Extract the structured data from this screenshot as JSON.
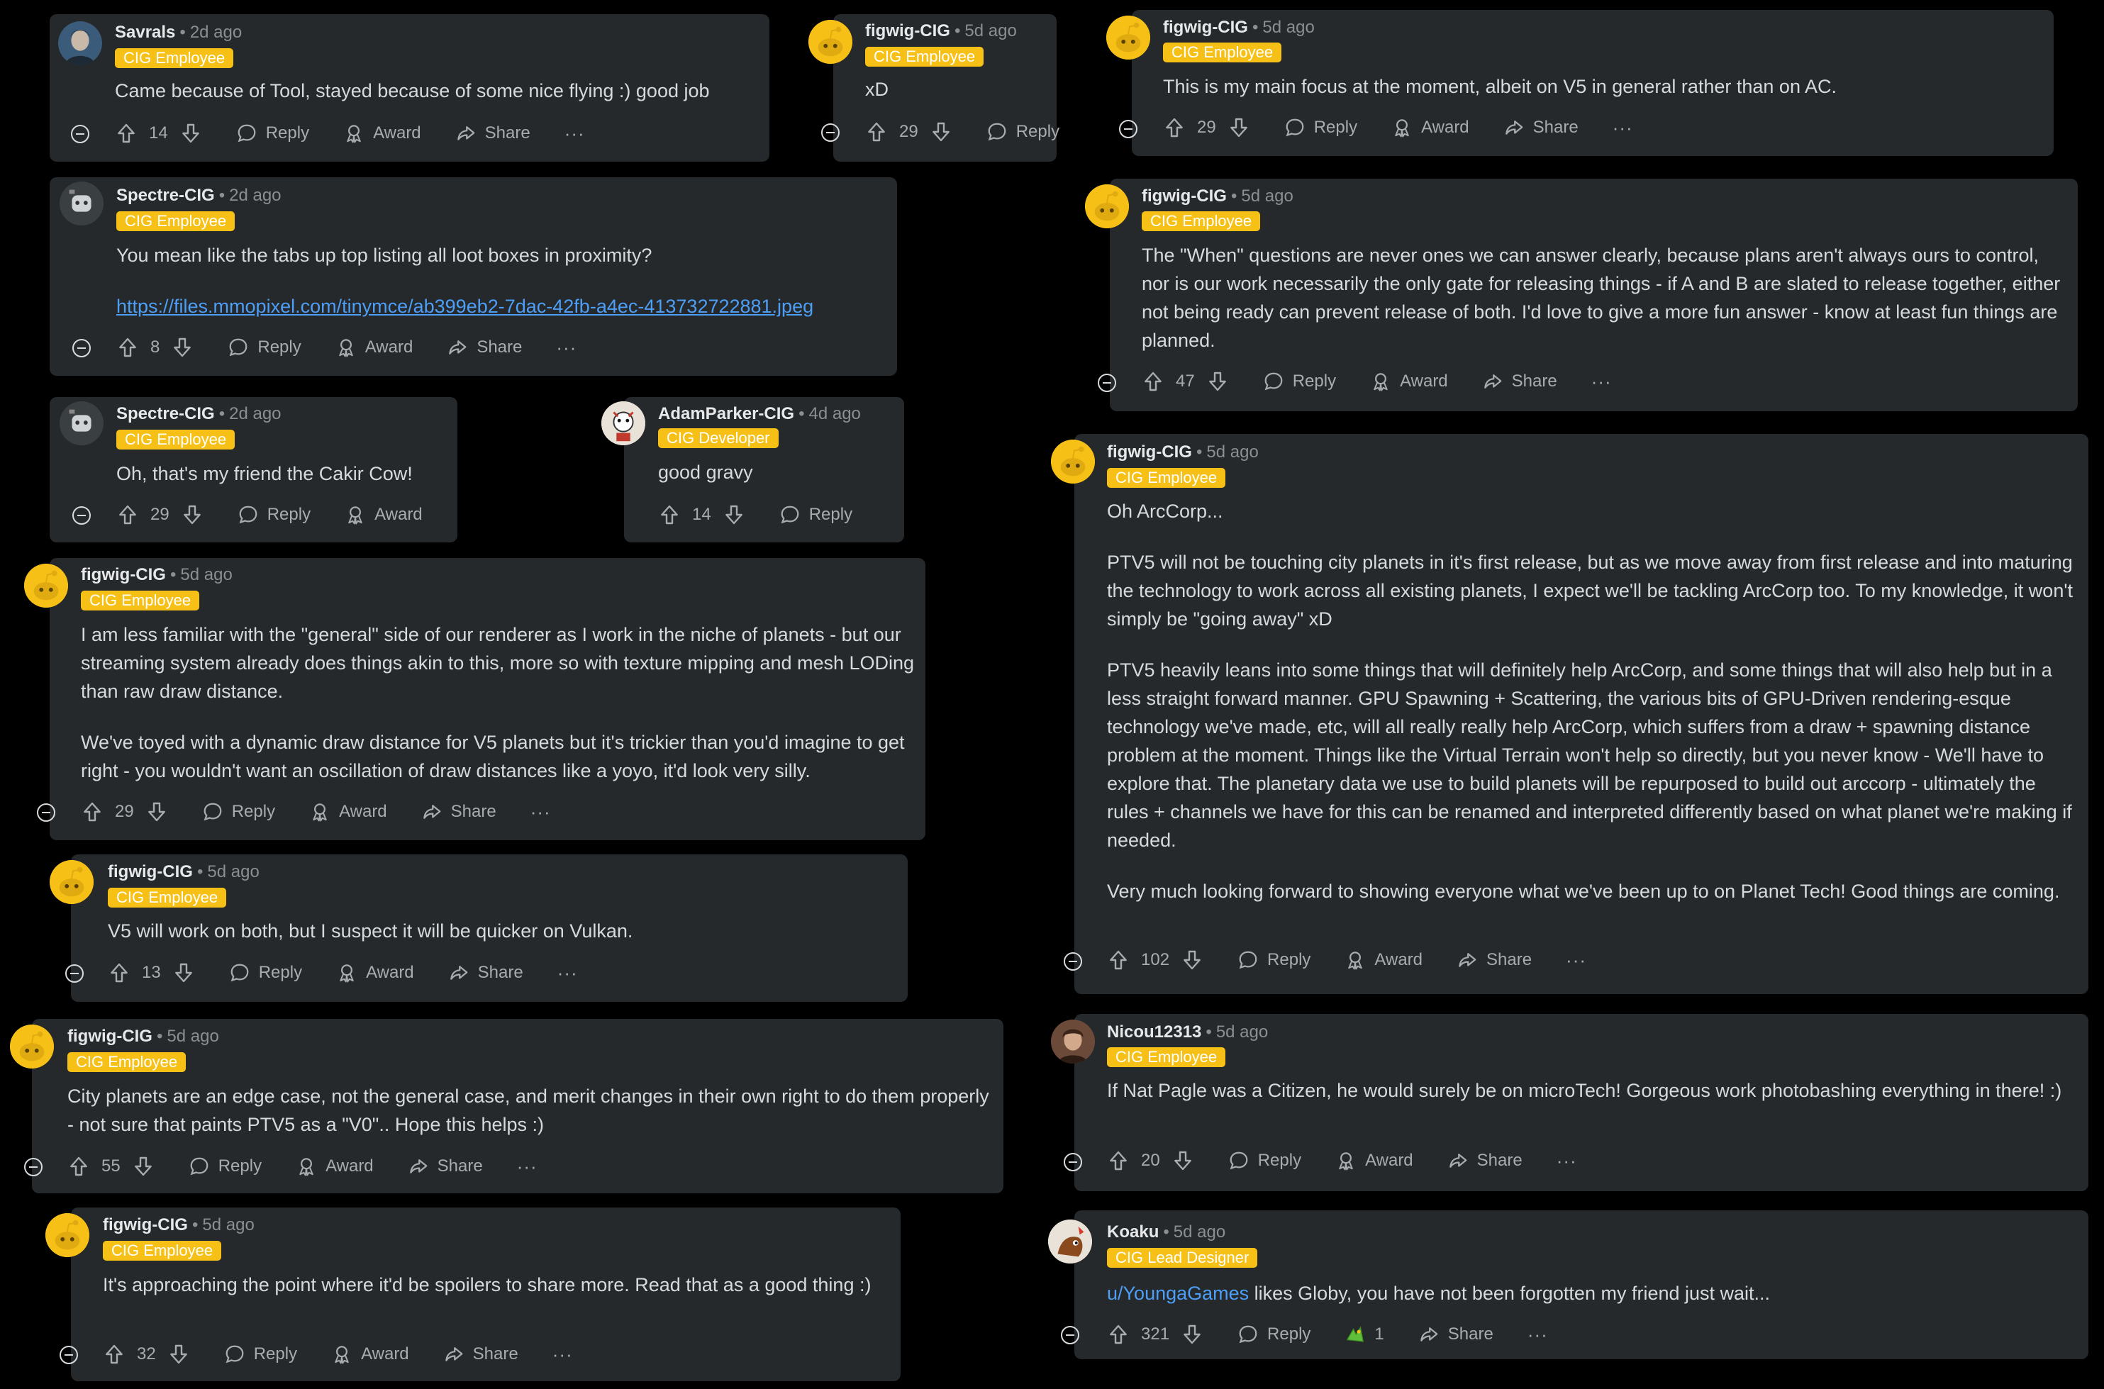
{
  "labels": {
    "reply": "Reply",
    "award": "Award",
    "share": "Share",
    "more": "···",
    "dot": "•"
  },
  "colors": {
    "background": "#000000",
    "card": "#25292b",
    "flair": "#f6c016",
    "upvoted": "#ff4500",
    "link": "#4d9ef6"
  },
  "comments": [
    {
      "user": "Savrals",
      "time": "2d ago",
      "flair": "CIG Employee",
      "text": "Came because of Tool, stayed because of some nice flying :) good job",
      "score": "14"
    },
    {
      "user": "figwig-CIG",
      "time": "5d ago",
      "flair": "CIG Employee",
      "text": "xD",
      "score": "29"
    },
    {
      "user": "figwig-CIG",
      "time": "5d ago",
      "flair": "CIG Employee",
      "text": "This is my main focus at the moment, albeit on V5 in general rather than on AC.",
      "score": "29"
    },
    {
      "user": "Spectre-CIG",
      "time": "2d ago",
      "flair": "CIG Employee",
      "text": "You mean like the tabs up top listing all loot boxes in proximity?",
      "link": "https://files.mmopixel.com/tinymce/ab399eb2-7dac-42fb-a4ec-413732722881.jpeg",
      "score": "8"
    },
    {
      "user": "figwig-CIG",
      "time": "5d ago",
      "flair": "CIG Employee",
      "text": "The \"When\" questions are never ones we can answer clearly, because plans aren't always ours to control, nor is our work necessarily the only gate for releasing things - if A and B are slated to release together, either not being ready can prevent release of both. I'd love to give a more fun answer - know at least fun things are planned.",
      "score": "47"
    },
    {
      "user": "Spectre-CIG",
      "time": "2d ago",
      "flair": "CIG Employee",
      "text": "Oh, that's my friend the Cakir Cow!",
      "score": "29"
    },
    {
      "user": "AdamParker-CIG",
      "time": "4d ago",
      "flair": "CIG Developer",
      "text": "good gravy",
      "score": "14"
    },
    {
      "user": "figwig-CIG",
      "time": "5d ago",
      "flair": "CIG Employee",
      "text": "Oh ArcCorp...",
      "paragraphs": [
        "PTV5 will not be touching city planets in it's first release, but as we move away from first release and into maturing the technology to work across all existing planets, I expect we'll be tackling ArcCorp too. To my knowledge, it won't simply be \"going away\" xD",
        "PTV5 heavily leans into some things that will definitely help ArcCorp, and some things that will also help but in a less straight forward manner. GPU Spawning + Scattering, the various bits of GPU-Driven rendering-esque technology we've made, etc, will all really really help ArcCorp, which suffers from a draw + spawning distance problem at the moment. Things like the Virtual Terrain won't help so directly, but you never know - We'll have to explore that. The planetary data we use to build planets will be repurposed to build out arccorp - ultimately the rules + channels we have for this can be renamed and interpreted differently based on what planet we're making if needed.",
        "Very much looking forward to showing everyone what we've been up to on Planet Tech! Good things are coming."
      ],
      "score": "102"
    },
    {
      "user": "figwig-CIG",
      "time": "5d ago",
      "flair": "CIG Employee",
      "paragraphs": [
        "I am less familiar with the \"general\" side of our renderer as I work in the niche of planets - but our streaming system already does things akin to this, more so with texture mipping and mesh LODing than raw draw distance.",
        "We've toyed with a dynamic draw distance for V5 planets but it's trickier than you'd imagine to get right - you wouldn't want an oscillation of draw distances like a yoyo, it'd look very silly."
      ],
      "score": "29"
    },
    {
      "user": "figwig-CIG",
      "time": "5d ago",
      "flair": "CIG Employee",
      "text": "V5 will work on both, but I suspect it will be quicker on Vulkan.",
      "score": "13"
    },
    {
      "user": "Nicou12313",
      "time": "5d ago",
      "flair": "CIG Employee",
      "text": "If Nat Pagle was a Citizen, he would surely be on microTech! Gorgeous work photobashing everything in there! :)",
      "score": "20"
    },
    {
      "user": "figwig-CIG",
      "time": "5d ago",
      "flair": "CIG Employee",
      "text": "City planets are an edge case, not the general case, and merit changes in their own right to do them properly - not sure that paints PTV5 as a \"V0\".. Hope this helps :)",
      "score": "55"
    },
    {
      "user": "Koaku",
      "time": "5d ago",
      "flair": "CIG Lead Designer",
      "mention": "u/YoungaGames",
      "text": " likes Globy, you have not been forgotten my friend just wait...",
      "score": "321",
      "award_count": "1"
    },
    {
      "user": "figwig-CIG",
      "time": "5d ago",
      "flair": "CIG Employee",
      "text": "It's approaching the point where it'd be spoilers to share more. Read that as a good thing :)",
      "score": "32"
    }
  ]
}
